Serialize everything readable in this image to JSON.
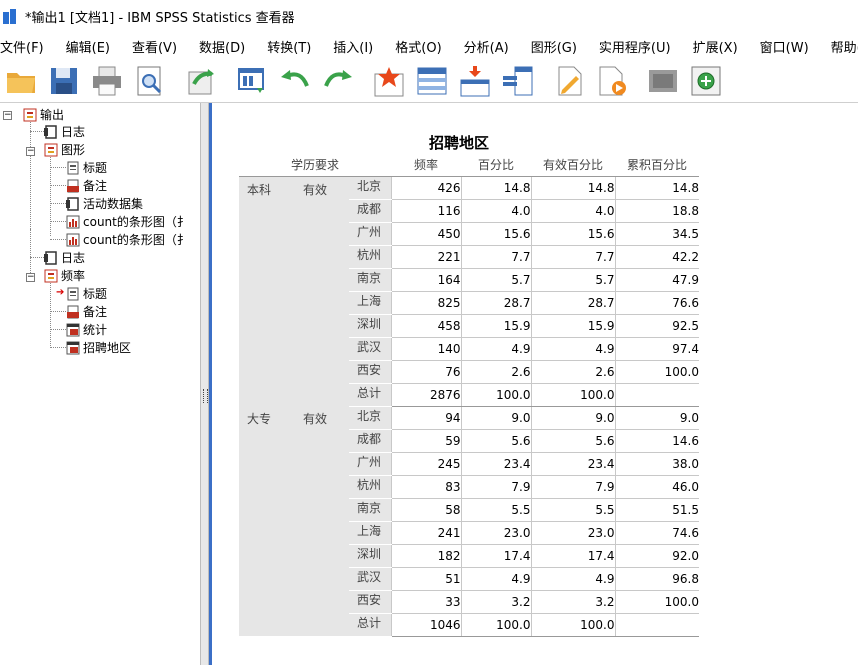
{
  "window": {
    "title": "*输出1 [文档1] - IBM SPSS Statistics 查看器"
  },
  "menu": [
    "文件(F)",
    "编辑(E)",
    "查看(V)",
    "数据(D)",
    "转换(T)",
    "插入(I)",
    "格式(O)",
    "分析(A)",
    "图形(G)",
    "实用程序(U)",
    "扩展(X)",
    "窗口(W)",
    "帮助(H)"
  ],
  "toolbar_icons": [
    "open-folder-icon",
    "save-icon",
    "print-icon",
    "print-preview-icon",
    "export-icon",
    "recall-dialog-icon",
    "undo-icon",
    "redo-icon",
    "go-to-data-icon",
    "go-to-case-icon",
    "go-to-variable-icon",
    "variables-icon",
    "show-all-icon",
    "select-icon",
    "hide-icon",
    "insert-icon"
  ],
  "tree": {
    "nodes": [
      {
        "label": "输出",
        "level": 0,
        "icon": "output-book-icon",
        "expanded": true
      },
      {
        "label": "日志",
        "level": 1,
        "icon": "log-icon"
      },
      {
        "label": "图形",
        "level": 1,
        "icon": "output-book-icon",
        "expanded": true
      },
      {
        "label": "标题",
        "level": 2,
        "icon": "title-icon"
      },
      {
        "label": "备注",
        "level": 2,
        "icon": "notes-icon"
      },
      {
        "label": "活动数据集",
        "level": 2,
        "icon": "log-icon"
      },
      {
        "label": "count的条形图（扌",
        "level": 2,
        "icon": "chart-icon"
      },
      {
        "label": "count的条形图（扌",
        "level": 2,
        "icon": "chart-icon"
      },
      {
        "label": "日志",
        "level": 1,
        "icon": "log-icon"
      },
      {
        "label": "频率",
        "level": 1,
        "icon": "output-book-icon",
        "expanded": true
      },
      {
        "label": "标题",
        "level": 2,
        "icon": "title-icon",
        "current": true
      },
      {
        "label": "备注",
        "level": 2,
        "icon": "notes-icon"
      },
      {
        "label": "统计",
        "level": 2,
        "icon": "table-icon"
      },
      {
        "label": "招聘地区",
        "level": 2,
        "icon": "table-icon"
      }
    ]
  },
  "table": {
    "title": "招聘地区",
    "header": {
      "label": "学历要求",
      "columns": [
        "频率",
        "百分比",
        "有效百分比",
        "累积百分比"
      ]
    },
    "groups": [
      {
        "education": "本科",
        "valid": "有效",
        "rows": [
          {
            "city": "北京",
            "freq": "426",
            "pct": "14.8",
            "vpct": "14.8",
            "cpct": "14.8"
          },
          {
            "city": "成都",
            "freq": "116",
            "pct": "4.0",
            "vpct": "4.0",
            "cpct": "18.8"
          },
          {
            "city": "广州",
            "freq": "450",
            "pct": "15.6",
            "vpct": "15.6",
            "cpct": "34.5"
          },
          {
            "city": "杭州",
            "freq": "221",
            "pct": "7.7",
            "vpct": "7.7",
            "cpct": "42.2"
          },
          {
            "city": "南京",
            "freq": "164",
            "pct": "5.7",
            "vpct": "5.7",
            "cpct": "47.9"
          },
          {
            "city": "上海",
            "freq": "825",
            "pct": "28.7",
            "vpct": "28.7",
            "cpct": "76.6"
          },
          {
            "city": "深圳",
            "freq": "458",
            "pct": "15.9",
            "vpct": "15.9",
            "cpct": "92.5"
          },
          {
            "city": "武汉",
            "freq": "140",
            "pct": "4.9",
            "vpct": "4.9",
            "cpct": "97.4"
          },
          {
            "city": "西安",
            "freq": "76",
            "pct": "2.6",
            "vpct": "2.6",
            "cpct": "100.0"
          },
          {
            "city": "总计",
            "freq": "2876",
            "pct": "100.0",
            "vpct": "100.0",
            "cpct": ""
          }
        ]
      },
      {
        "education": "大专",
        "valid": "有效",
        "rows": [
          {
            "city": "北京",
            "freq": "94",
            "pct": "9.0",
            "vpct": "9.0",
            "cpct": "9.0"
          },
          {
            "city": "成都",
            "freq": "59",
            "pct": "5.6",
            "vpct": "5.6",
            "cpct": "14.6"
          },
          {
            "city": "广州",
            "freq": "245",
            "pct": "23.4",
            "vpct": "23.4",
            "cpct": "38.0"
          },
          {
            "city": "杭州",
            "freq": "83",
            "pct": "7.9",
            "vpct": "7.9",
            "cpct": "46.0"
          },
          {
            "city": "南京",
            "freq": "58",
            "pct": "5.5",
            "vpct": "5.5",
            "cpct": "51.5"
          },
          {
            "city": "上海",
            "freq": "241",
            "pct": "23.0",
            "vpct": "23.0",
            "cpct": "74.6"
          },
          {
            "city": "深圳",
            "freq": "182",
            "pct": "17.4",
            "vpct": "17.4",
            "cpct": "92.0"
          },
          {
            "city": "武汉",
            "freq": "51",
            "pct": "4.9",
            "vpct": "4.9",
            "cpct": "96.8"
          },
          {
            "city": "西安",
            "freq": "33",
            "pct": "3.2",
            "vpct": "3.2",
            "cpct": "100.0"
          },
          {
            "city": "总计",
            "freq": "1046",
            "pct": "100.0",
            "vpct": "100.0",
            "cpct": ""
          }
        ]
      }
    ]
  }
}
